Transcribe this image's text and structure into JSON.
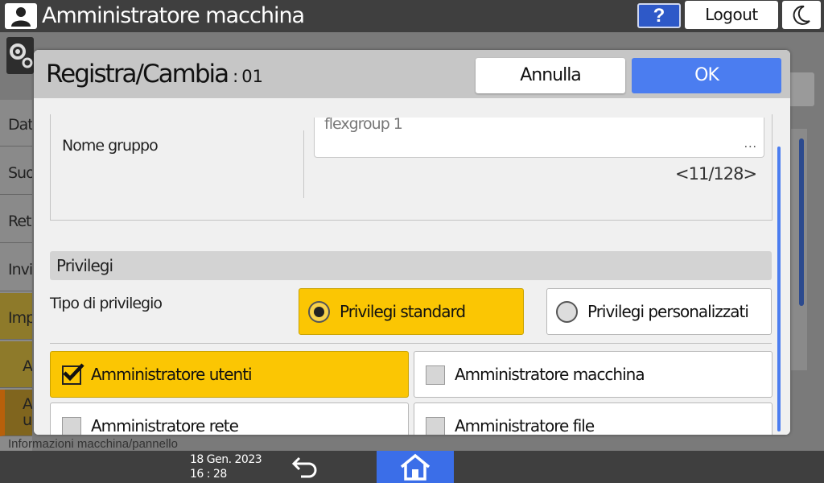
{
  "topbar": {
    "title": "Amministratore macchina",
    "help_label": "?",
    "logout_label": "Logout"
  },
  "background": {
    "sidebar_items": [
      "Dat",
      "Suo",
      "Ret",
      "Invi",
      "Imp",
      "A",
      "A u"
    ],
    "bottom_text": "Informazioni macchina/pannello"
  },
  "dialog": {
    "title": "Registra/Cambia",
    "separator": ":",
    "number": "01",
    "cancel_label": "Annulla",
    "ok_label": "OK",
    "group": {
      "label": "Nome gruppo",
      "value": "flexgroup 1",
      "more": "...",
      "counter": "<11/128>"
    },
    "privileges": {
      "section_title": "Privilegi",
      "type_label": "Tipo di privilegio",
      "options": [
        {
          "label": "Privilegi standard",
          "selected": true
        },
        {
          "label": "Privilegi personalizzati",
          "selected": false
        }
      ],
      "roles": [
        {
          "label": "Amministratore utenti",
          "checked": true
        },
        {
          "label": "Amministratore macchina",
          "checked": false
        },
        {
          "label": "Amministratore rete",
          "checked": false
        },
        {
          "label": "Amministratore file",
          "checked": false
        }
      ]
    }
  },
  "bottombar": {
    "date": "18 Gen. 2023",
    "time": "16 : 28"
  },
  "colors": {
    "accent_blue": "#4b7df0",
    "selected_yellow": "#fbc603",
    "bar_dark": "#3f3f3f"
  },
  "icons": [
    "user-icon",
    "moon-icon",
    "gear-icon",
    "back-arrow-icon",
    "home-icon",
    "check-icon",
    "radio-icon"
  ]
}
